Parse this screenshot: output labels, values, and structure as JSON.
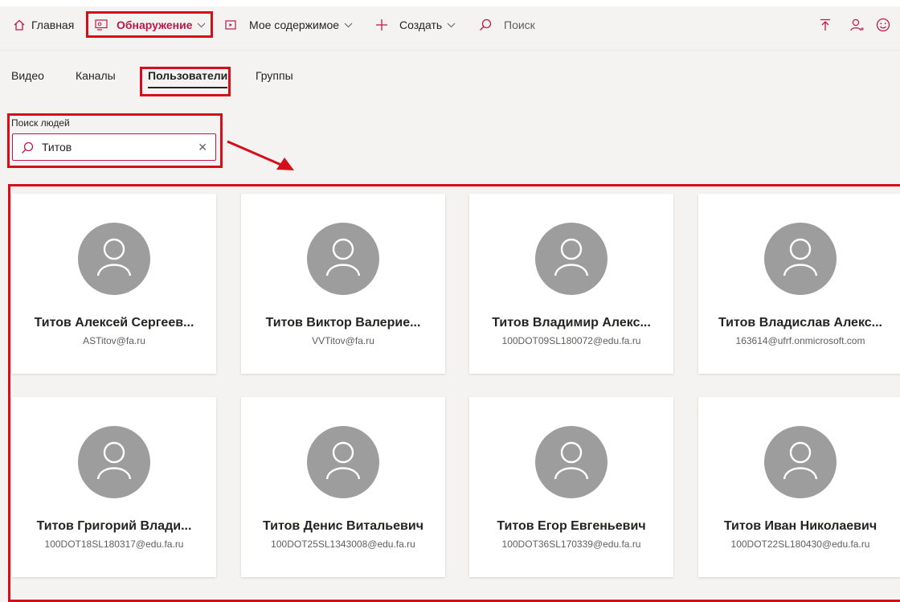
{
  "nav": {
    "home_label": "Главная",
    "discover_label": "Обнаружение",
    "my_content_label": "Мое содержимое",
    "create_label": "Создать",
    "search_label": "Поиск"
  },
  "tabs": [
    {
      "label": "Видео",
      "active": false
    },
    {
      "label": "Каналы",
      "active": false
    },
    {
      "label": "Пользователи",
      "active": true
    },
    {
      "label": "Группы",
      "active": false
    }
  ],
  "people_search": {
    "label": "Поиск людей",
    "value": "Титов"
  },
  "people": [
    {
      "name": "Титов Алексей Сергеев...",
      "email": "ASTitov@fa.ru"
    },
    {
      "name": "Титов Виктор Валерие...",
      "email": "VVTitov@fa.ru"
    },
    {
      "name": "Титов Владимир Алекс...",
      "email": "100DOT09SL180072@edu.fa.ru"
    },
    {
      "name": "Титов Владислав Алекс...",
      "email": "163614@ufrf.onmicrosoft.com"
    },
    {
      "name": "Титов Григорий Влади...",
      "email": "100DOT18SL180317@edu.fa.ru"
    },
    {
      "name": "Титов Денис Витальевич",
      "email": "100DOT25SL1343008@edu.fa.ru"
    },
    {
      "name": "Титов Егор Евгеньевич",
      "email": "100DOT36SL170339@edu.fa.ru"
    },
    {
      "name": "Титов Иван Николаевич",
      "email": "100DOT22SL180430@edu.fa.ru"
    }
  ],
  "colors": {
    "accent": "#bc1948",
    "annotation": "#d50f19",
    "avatar": "#9d9d9d"
  }
}
